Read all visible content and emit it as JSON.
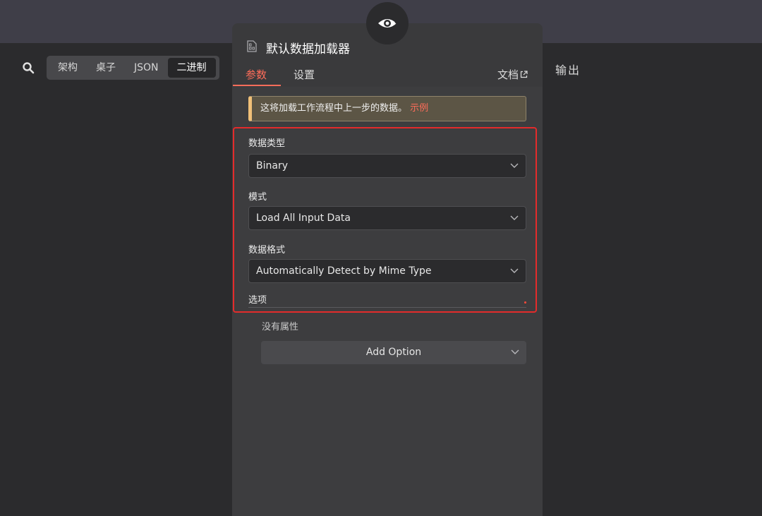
{
  "input_view": {
    "options": [
      "架构",
      "桌子",
      "JSON",
      "二进制"
    ],
    "active": "二进制"
  },
  "output": {
    "label": "输出"
  },
  "node": {
    "title": "默认数据加载器",
    "tabs": {
      "params": "参数",
      "settings": "设置"
    },
    "docs_label": "文档"
  },
  "notice": {
    "text": "这将加载工作流程中上一步的数据。",
    "link": "示例"
  },
  "fields": {
    "data_type": {
      "label": "数据类型",
      "value": "Binary"
    },
    "mode": {
      "label": "模式",
      "value": "Load All Input Data"
    },
    "data_format": {
      "label": "数据格式",
      "value": "Automatically Detect by Mime Type"
    }
  },
  "options": {
    "label": "选项",
    "empty_text": "没有属性",
    "add_button": "Add Option"
  },
  "colors": {
    "accent": "#ff6d5a",
    "highlight_border": "#e42b2b",
    "notice_bar": "#f0c078"
  }
}
